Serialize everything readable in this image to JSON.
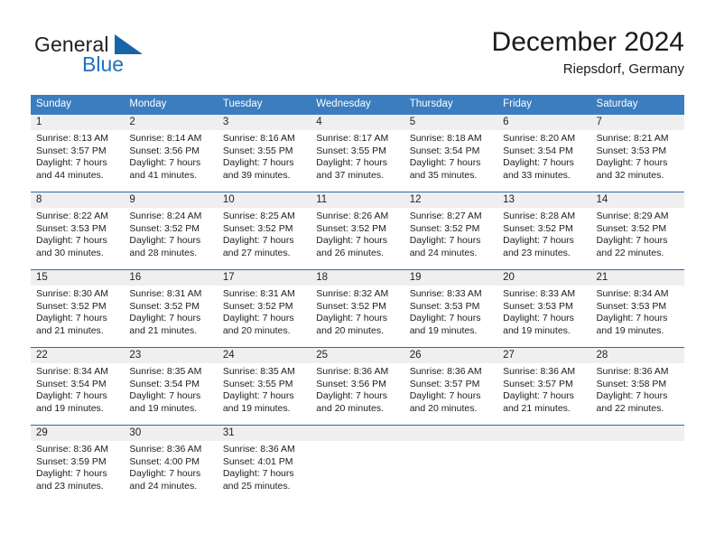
{
  "brand": {
    "name_top": "General",
    "name_bottom": "Blue",
    "accent_color": "#1764a8"
  },
  "header": {
    "title": "December 2024",
    "subtitle": "Riepsdorf, Germany"
  },
  "calendar": {
    "header_bg": "#3b7dbf",
    "row_divider_color": "#2c6ca8",
    "daynum_band_bg": "#efefef",
    "weekday_headers": [
      "Sunday",
      "Monday",
      "Tuesday",
      "Wednesday",
      "Thursday",
      "Friday",
      "Saturday"
    ],
    "weeks": [
      [
        {
          "day": "1",
          "info": "Sunrise: 8:13 AM\nSunset: 3:57 PM\nDaylight: 7 hours and 44 minutes."
        },
        {
          "day": "2",
          "info": "Sunrise: 8:14 AM\nSunset: 3:56 PM\nDaylight: 7 hours and 41 minutes."
        },
        {
          "day": "3",
          "info": "Sunrise: 8:16 AM\nSunset: 3:55 PM\nDaylight: 7 hours and 39 minutes."
        },
        {
          "day": "4",
          "info": "Sunrise: 8:17 AM\nSunset: 3:55 PM\nDaylight: 7 hours and 37 minutes."
        },
        {
          "day": "5",
          "info": "Sunrise: 8:18 AM\nSunset: 3:54 PM\nDaylight: 7 hours and 35 minutes."
        },
        {
          "day": "6",
          "info": "Sunrise: 8:20 AM\nSunset: 3:54 PM\nDaylight: 7 hours and 33 minutes."
        },
        {
          "day": "7",
          "info": "Sunrise: 8:21 AM\nSunset: 3:53 PM\nDaylight: 7 hours and 32 minutes."
        }
      ],
      [
        {
          "day": "8",
          "info": "Sunrise: 8:22 AM\nSunset: 3:53 PM\nDaylight: 7 hours and 30 minutes."
        },
        {
          "day": "9",
          "info": "Sunrise: 8:24 AM\nSunset: 3:52 PM\nDaylight: 7 hours and 28 minutes."
        },
        {
          "day": "10",
          "info": "Sunrise: 8:25 AM\nSunset: 3:52 PM\nDaylight: 7 hours and 27 minutes."
        },
        {
          "day": "11",
          "info": "Sunrise: 8:26 AM\nSunset: 3:52 PM\nDaylight: 7 hours and 26 minutes."
        },
        {
          "day": "12",
          "info": "Sunrise: 8:27 AM\nSunset: 3:52 PM\nDaylight: 7 hours and 24 minutes."
        },
        {
          "day": "13",
          "info": "Sunrise: 8:28 AM\nSunset: 3:52 PM\nDaylight: 7 hours and 23 minutes."
        },
        {
          "day": "14",
          "info": "Sunrise: 8:29 AM\nSunset: 3:52 PM\nDaylight: 7 hours and 22 minutes."
        }
      ],
      [
        {
          "day": "15",
          "info": "Sunrise: 8:30 AM\nSunset: 3:52 PM\nDaylight: 7 hours and 21 minutes."
        },
        {
          "day": "16",
          "info": "Sunrise: 8:31 AM\nSunset: 3:52 PM\nDaylight: 7 hours and 21 minutes."
        },
        {
          "day": "17",
          "info": "Sunrise: 8:31 AM\nSunset: 3:52 PM\nDaylight: 7 hours and 20 minutes."
        },
        {
          "day": "18",
          "info": "Sunrise: 8:32 AM\nSunset: 3:52 PM\nDaylight: 7 hours and 20 minutes."
        },
        {
          "day": "19",
          "info": "Sunrise: 8:33 AM\nSunset: 3:53 PM\nDaylight: 7 hours and 19 minutes."
        },
        {
          "day": "20",
          "info": "Sunrise: 8:33 AM\nSunset: 3:53 PM\nDaylight: 7 hours and 19 minutes."
        },
        {
          "day": "21",
          "info": "Sunrise: 8:34 AM\nSunset: 3:53 PM\nDaylight: 7 hours and 19 minutes."
        }
      ],
      [
        {
          "day": "22",
          "info": "Sunrise: 8:34 AM\nSunset: 3:54 PM\nDaylight: 7 hours and 19 minutes."
        },
        {
          "day": "23",
          "info": "Sunrise: 8:35 AM\nSunset: 3:54 PM\nDaylight: 7 hours and 19 minutes."
        },
        {
          "day": "24",
          "info": "Sunrise: 8:35 AM\nSunset: 3:55 PM\nDaylight: 7 hours and 19 minutes."
        },
        {
          "day": "25",
          "info": "Sunrise: 8:36 AM\nSunset: 3:56 PM\nDaylight: 7 hours and 20 minutes."
        },
        {
          "day": "26",
          "info": "Sunrise: 8:36 AM\nSunset: 3:57 PM\nDaylight: 7 hours and 20 minutes."
        },
        {
          "day": "27",
          "info": "Sunrise: 8:36 AM\nSunset: 3:57 PM\nDaylight: 7 hours and 21 minutes."
        },
        {
          "day": "28",
          "info": "Sunrise: 8:36 AM\nSunset: 3:58 PM\nDaylight: 7 hours and 22 minutes."
        }
      ],
      [
        {
          "day": "29",
          "info": "Sunrise: 8:36 AM\nSunset: 3:59 PM\nDaylight: 7 hours and 23 minutes."
        },
        {
          "day": "30",
          "info": "Sunrise: 8:36 AM\nSunset: 4:00 PM\nDaylight: 7 hours and 24 minutes."
        },
        {
          "day": "31",
          "info": "Sunrise: 8:36 AM\nSunset: 4:01 PM\nDaylight: 7 hours and 25 minutes."
        },
        {
          "day": "",
          "info": ""
        },
        {
          "day": "",
          "info": ""
        },
        {
          "day": "",
          "info": ""
        },
        {
          "day": "",
          "info": ""
        }
      ]
    ]
  }
}
